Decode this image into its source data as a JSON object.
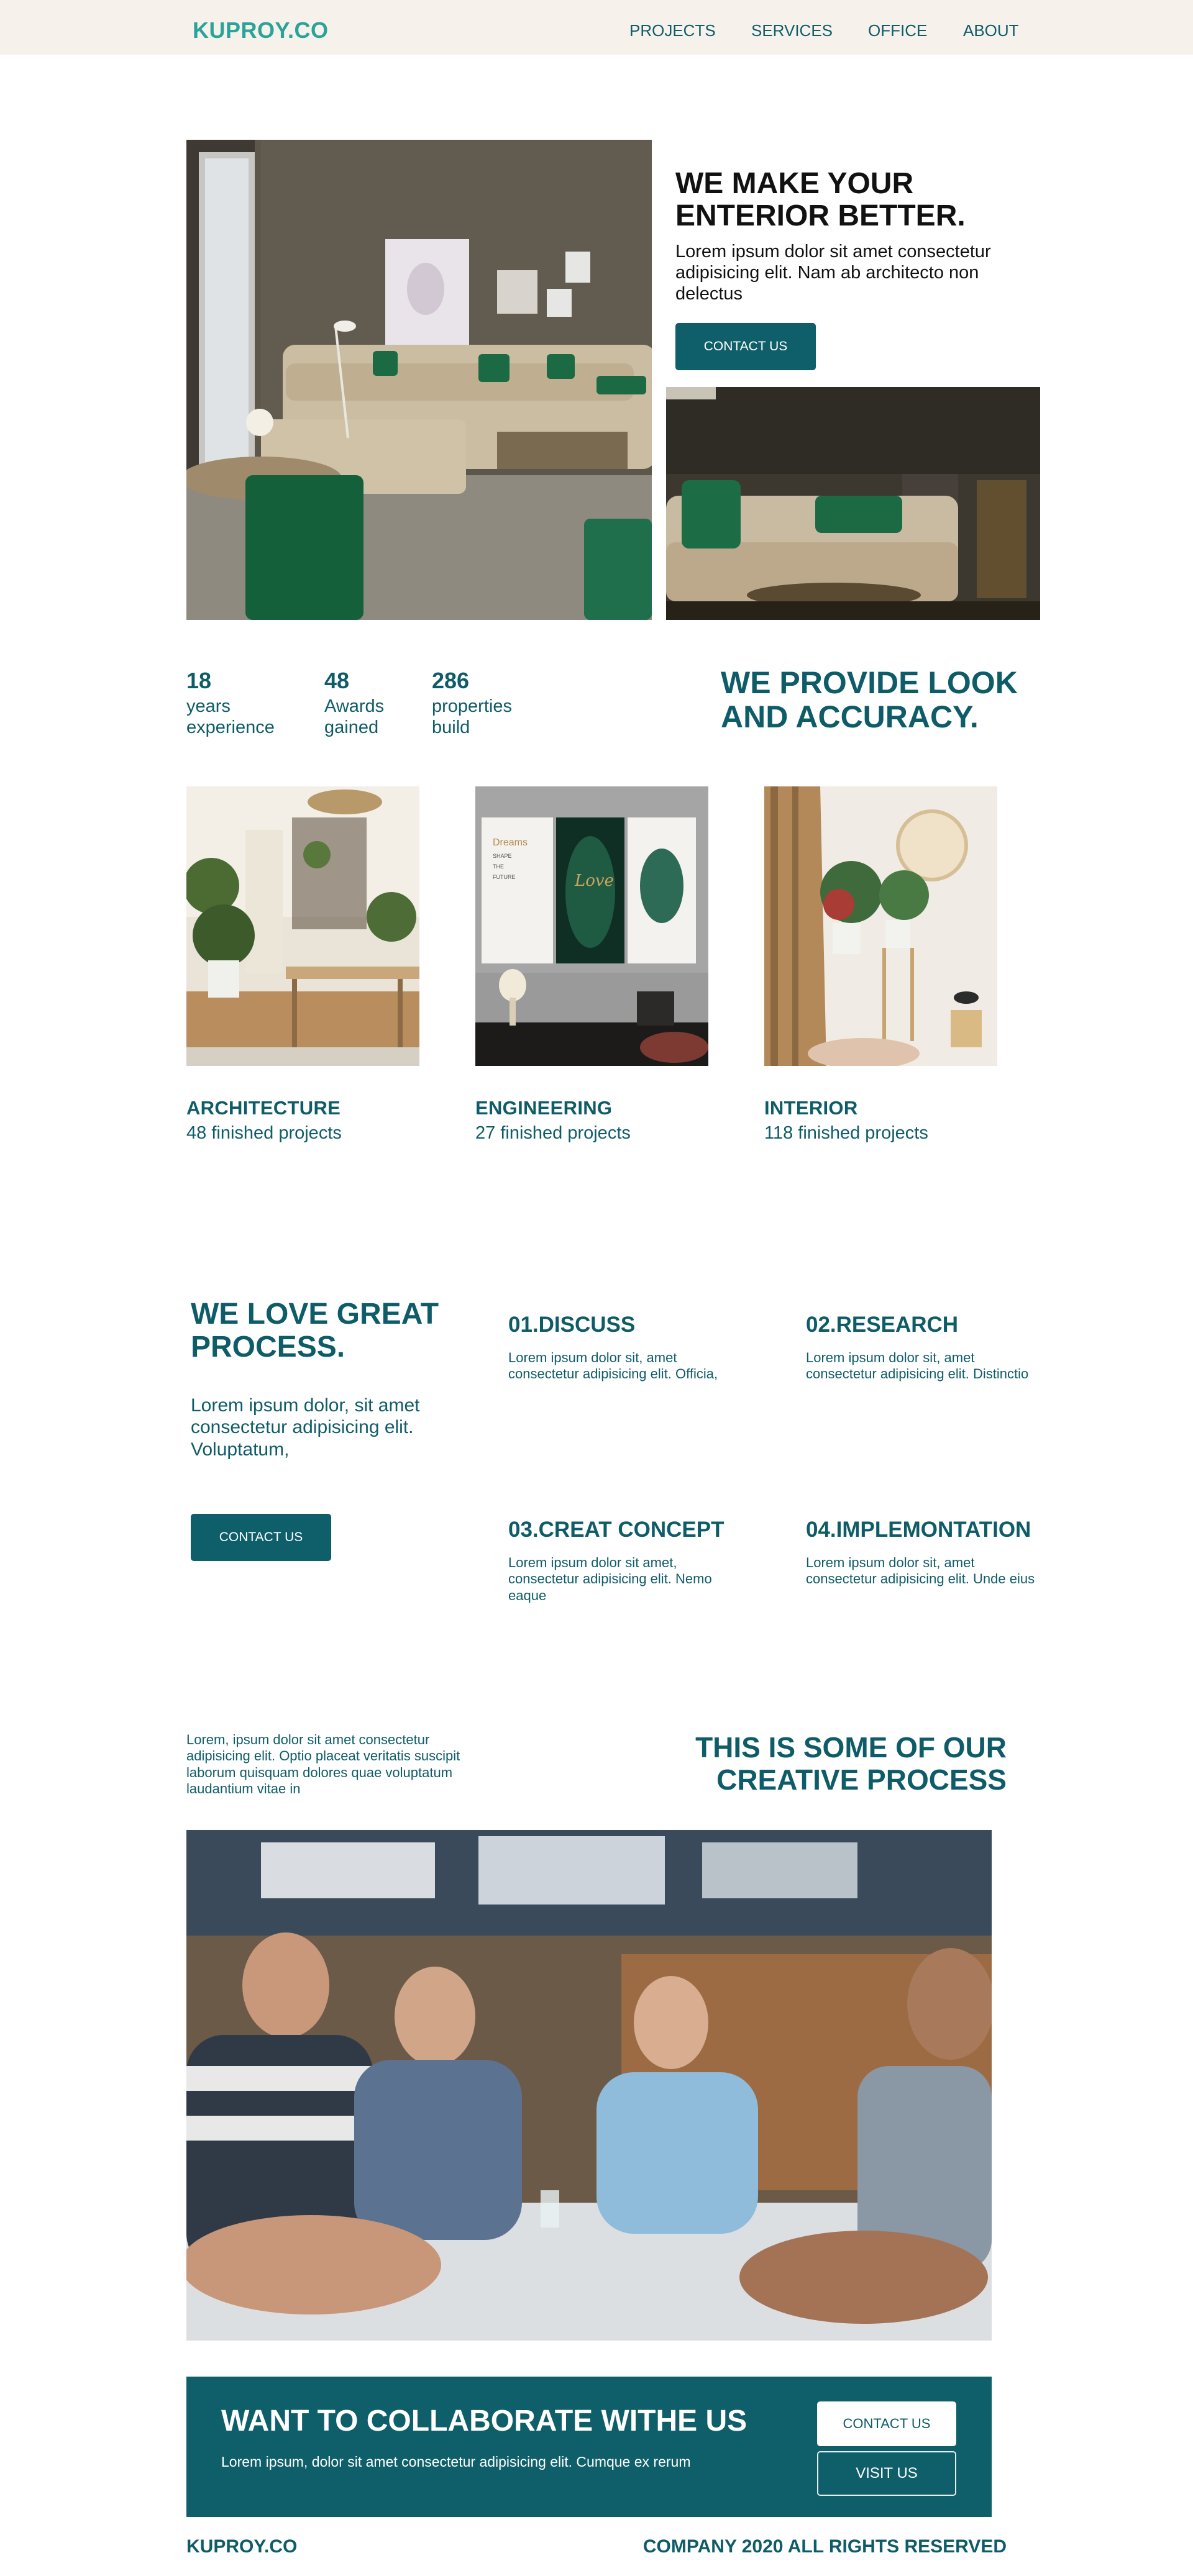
{
  "header": {
    "logo": "KUPROY.CO",
    "nav": [
      "PROJECTS",
      "SERVICES",
      "OFFICE",
      "ABOUT"
    ]
  },
  "hero": {
    "title": "WE MAKE YOUR ENTERIOR BETTER.",
    "text": "Lorem ipsum dolor sit amet consectetur adipisicing elit. Nam ab architecto non delectus",
    "button": "CONTACT US"
  },
  "stats": [
    {
      "number": "18",
      "label": "years experience"
    },
    {
      "number": "48",
      "label": "Awards gained"
    },
    {
      "number": "286",
      "label": "properties build"
    }
  ],
  "provide_title": "WE PROVIDE LOOK AND ACCURACY.",
  "services": [
    {
      "title": "ARCHITECTURE",
      "count": "48 finished projects"
    },
    {
      "title": "ENGINEERING",
      "count": "27 finished projects"
    },
    {
      "title": "INTERIOR",
      "count": "118 finished projects"
    }
  ],
  "poster_text": {
    "word": "Dreams",
    "line1": "SHAPE",
    "line2": "THE",
    "line3": "FUTURE",
    "script": "Love"
  },
  "process": {
    "title": "WE LOVE GREAT PROCESS.",
    "text": "Lorem ipsum dolor, sit amet consectetur adipisicing elit. Voluptatum,",
    "button": "CONTACT US",
    "steps": [
      {
        "title": "01.DISCUSS",
        "text": "Lorem ipsum dolor sit, amet consectetur adipisicing elit. Officia,"
      },
      {
        "title": "02.RESEARCH",
        "text": "Lorem ipsum dolor sit, amet consectetur adipisicing elit. Distinctio"
      },
      {
        "title": "03.CREAT CONCEPT",
        "text": "Lorem ipsum dolor sit amet, consectetur adipisicing elit. Nemo eaque"
      },
      {
        "title": "04.IMPLEMONTATION",
        "text": "Lorem ipsum dolor sit, amet consectetur adipisicing elit. Unde eius"
      }
    ]
  },
  "creative": {
    "text": "Lorem, ipsum dolor sit amet consectetur adipisicing elit. Optio placeat veritatis suscipit laborum quisquam dolores quae voluptatum laudantium vitae in",
    "title": "THIS IS SOME OF OUR CREATIVE PROCESS"
  },
  "cta": {
    "title": "WANT TO COLLABORATE WITHE US",
    "text": "Lorem ipsum, dolor sit amet consectetur adipisicing elit. Cumque ex rerum",
    "contact_button": "CONTACT US",
    "visit_button": "VISIT US"
  },
  "footer": {
    "logo": "KUPROY.CO",
    "copyright": "COMPANY 2020 ALL RIGHTS RESERVED"
  },
  "colors": {
    "brand_teal": "#0e5f69",
    "logo_teal": "#2aa398",
    "header_bg": "#f7f1ec"
  }
}
